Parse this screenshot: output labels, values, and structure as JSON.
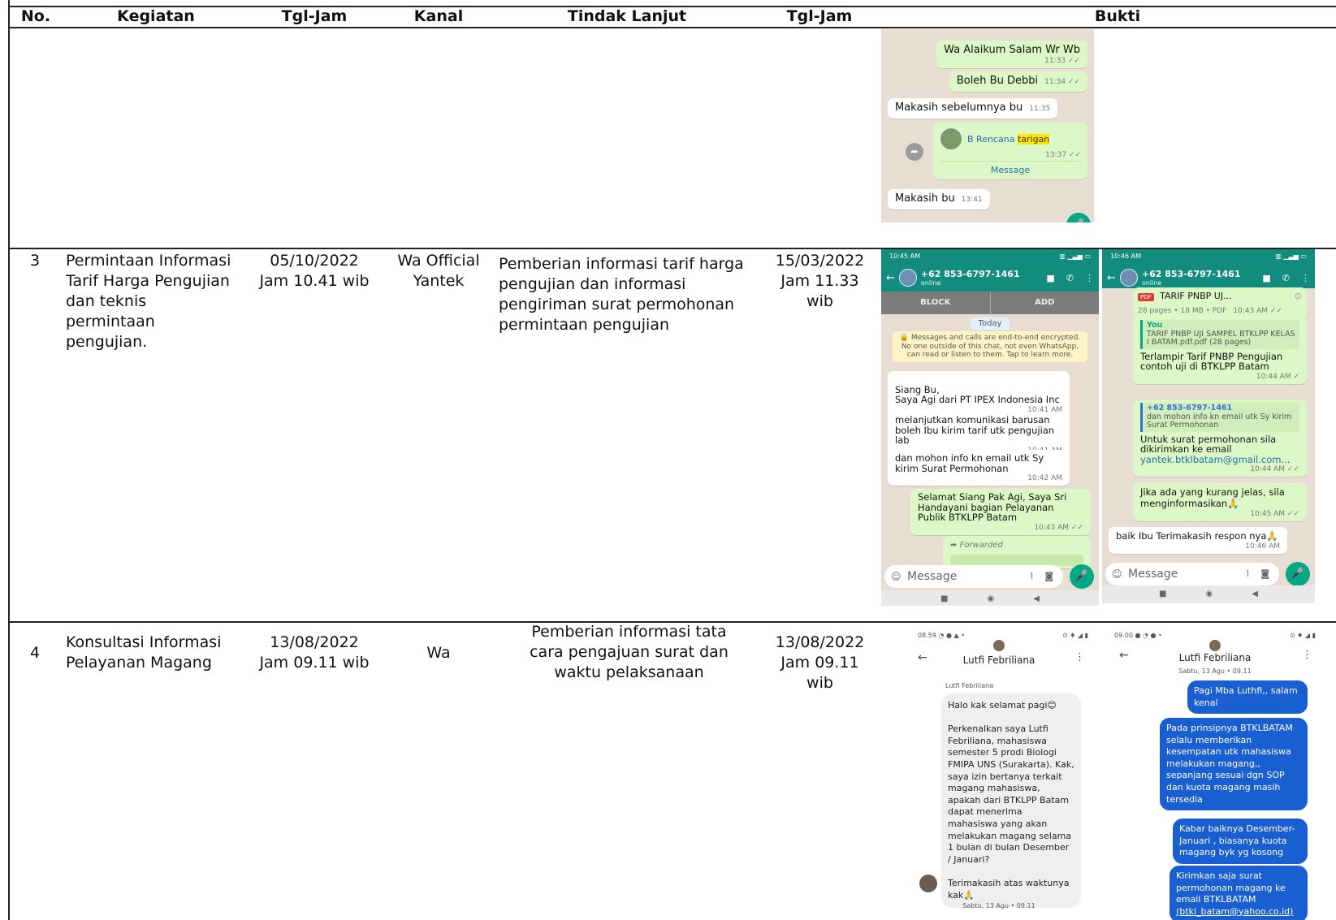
{
  "header": {
    "no": "No.",
    "kegiatan": "Kegiatan",
    "tgl_jam_1": "Tgl-Jam",
    "kanal": "Kanal",
    "tindak_lanjut": "Tindak Lanjut",
    "tgl_jam_2": "Tgl-Jam",
    "bukti": "Bukti"
  },
  "rows": [
    {
      "no": "3",
      "kegiatan": "Permintaan Informasi Tarif Harga Pengujian dan teknis permintaan pengujian.",
      "tanggal": "05/10/2022",
      "jam": "Jam 10.41 wib",
      "kanal_line1": "Wa Official",
      "kanal_line2": "Yantek",
      "tindak_lanjut": "Pemberian informasi tarif harga pengujian dan informasi pengiriman surat permohonan permintaan pengujian",
      "tanggal_2": "15/03/2022",
      "jam_2": "Jam 11.33 wib"
    },
    {
      "no": "4",
      "kegiatan": "Konsultasi Informasi Pelayanan Magang",
      "tanggal": "13/08/2022",
      "jam": "Jam 09.11 wib",
      "kanal": "Wa",
      "tindak_lanjut": "Pemberian informasi tata cara pengajuan surat dan waktu pelaksanaan",
      "tanggal_2": "13/08/2022",
      "jam_2": "Jam 09.11 wib"
    }
  ],
  "shot_top": {
    "msg1": "Wa Alaikum Salam Wr Wb",
    "msg1_time": "11:33 ✓✓",
    "msg2": "Boleh Bu Debbi",
    "msg2_time": "11:34 ✓✓",
    "msg3": "Makasih sebelumnya bu",
    "msg3_time": "11:35",
    "contact_name": "B Rencana",
    "contact_highlight": "tarigan",
    "contact_time": "13:37 ✓✓",
    "contact_action": "Message",
    "msg4": "Makasih bu",
    "msg4_time": "13:41"
  },
  "shot_a": {
    "status_time": "10:45 AM",
    "phone": "+62 853-6797-1461",
    "status": "online",
    "block": "BLOCK",
    "add": "ADD",
    "today": "Today",
    "encryption": "🔒 Messages and calls are end-to-end encrypted. No one outside of this chat, not even WhatsApp, can read or listen to them. Tap to learn more.",
    "m1": "Siang Bu,\nSaya Agi dari PT IPEX Indonesia Inc",
    "m1_time": "10:41 AM",
    "m2": "melanjutkan komunikasi barusan boleh Ibu kirim tarif utk pengujian lab",
    "m2_time": "10:41 AM",
    "m3": "dan mohon info kn email utk Sy kirim Surat Permohonan",
    "m3_time": "10:42 AM",
    "m4": "Selamat Siang Pak Agi, Saya Sri Handayani bagian Pelayanan Publik BTKLPP Batam",
    "m4_time": "10:43 AM ✓✓",
    "forwarded": "Forwarded",
    "input": "Message"
  },
  "shot_b": {
    "status_time": "10:46 AM",
    "phone": "+62 853-6797-1461",
    "status": "online",
    "file_title": "TARIF PNBP UJ...",
    "file_meta": "28 pages • 18 MB • PDF",
    "file_time": "10:43 AM ✓✓",
    "reply_who": "You",
    "reply_text": "TARIF PNBP UJI SAMPEL BTKLPP KELAS I BATAM.pdf.pdf (28 pages)",
    "m1": "Terlampir Tarif PNBP Pengujian contoh uji di BTKLPP Batam",
    "m1_time": "10:44 AM ✓",
    "quote_who": "+62 853-6797-1461",
    "quote_text": "dan mohon info kn email utk Sy kirim Surat Permohonan",
    "m2": "Untuk surat permohonan sila dikirimkan ke email",
    "m2_email": "yantek.btklbatam@gmail.com...",
    "m2_time": "10:44 AM ✓✓",
    "m3": "Jika ada yang kurang jelas, sila menginformasikan🙏",
    "m3_time": "10:45 AM ✓✓",
    "m4": "baik Ibu Terimakasih respon nya🙏",
    "m4_time": "10:46 AM",
    "input": "Message"
  },
  "shot_c": {
    "status_time": "08.59",
    "contact": "Lutfi Febriliana",
    "sender_label": "Lutfi Febriliana",
    "message": "Halo kak selamat pagi😊\n\nPerkenalkan saya Lutfi Febriliana, mahasiswa semester 5 prodi Biologi FMIPA UNS (Surakarta). Kak, saya izin bertanya terkait magang mahasiswa, apakah dari BTKLPP Batam dapat menerima mahasiswa yang akan melakukan magang selama 1 bulan di bulan Desember / Januari?\n\nTerimakasih atas waktunya kak🙏",
    "date_footer": "Sabtu, 13 Agu • 09.11"
  },
  "shot_d": {
    "status_time": "09.00",
    "contact": "Lutfi Febriliana",
    "date": "Sabtu, 13 Agu • 09.11",
    "r1": "Pagi Mba Luthfi,, salam kenal",
    "r2": "Pada prinsipnya BTKLBATAM selalu memberikan kesempatan utk mahasiswa melakukan magang,, sepanjang sesuai dgn SOP dan kuota magang masih tersedia",
    "r3": "Kabar baiknya Desember-Januari , biasanya kuota magang byk yg kosong",
    "r4": "Kirimkan saja surat permohonan magang ke email BTKLBATAM",
    "r4_email": "(btkl_batam@yahoo.co.id)"
  }
}
